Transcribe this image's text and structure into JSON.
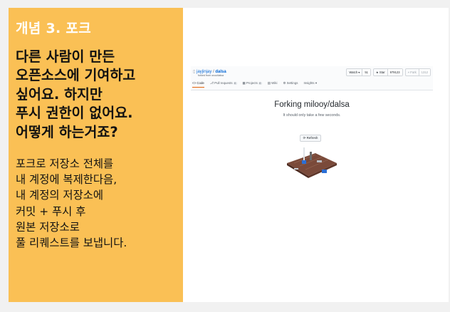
{
  "slide": {
    "concept_title": "개념 3. 포크",
    "question_lines": [
      "다른 사람이 만든",
      "오픈소스에 기여하고",
      "싶어요. 하지만",
      "푸시 권한이 없어요.",
      "어떻게 하는거죠?"
    ],
    "answer_lines": [
      "포크로 저장소 전체를",
      "내 계정에 복제한다음,",
      "내 계정의 저장소에",
      "커밋 + 푸시 후",
      "원본 저장소로",
      "풀 리퀘스트를 보냅니다."
    ],
    "accent_color": "#fac055"
  },
  "screenshot": {
    "repo_owner": "jayjinjay",
    "repo_name": "dalsa",
    "forked_from": "forked from oroo/dalsa",
    "watch_label": "Watch ▾",
    "watch_count": "51",
    "star_label": "★ Star",
    "star_count": "979123",
    "fork_label": "⑂ Fork",
    "fork_count": "1312",
    "tabs": [
      {
        "label": "<> Code",
        "badge": ""
      },
      {
        "label": "⎇ Pull requests",
        "badge": "0"
      },
      {
        "label": "▦ Projects",
        "badge": "0"
      },
      {
        "label": "▤ Wiki",
        "badge": ""
      },
      {
        "label": "⚙ Settings",
        "badge": ""
      },
      {
        "label": "Insights ▾",
        "badge": ""
      }
    ],
    "forking_title": "Forking milooy/dalsa",
    "forking_subtitle": "It should only take a few seconds.",
    "refresh_label": "⟳ Refresh",
    "link_color": "#0366d6"
  }
}
